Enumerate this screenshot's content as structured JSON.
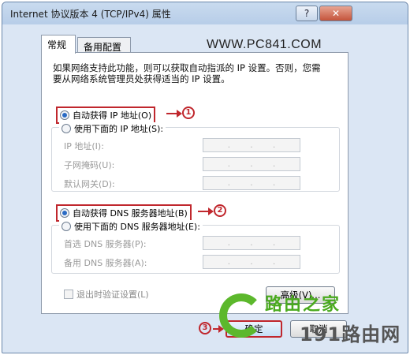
{
  "window": {
    "title": "Internet 协议版本 4 (TCP/IPv4) 属性",
    "help_label": "?",
    "close_label": "✕"
  },
  "tabs": [
    {
      "label": "常规"
    },
    {
      "label": "备用配置"
    }
  ],
  "watermark_top": "WWW.PC841.COM",
  "description": "如果网络支持此功能，则可以获取自动指派的 IP 设置。否则，您需要从网络系统管理员处获得适当的 IP 设置。",
  "ip_section": {
    "auto_label": "自动获得 IP 地址(O)",
    "manual_label": "使用下面的 IP 地址(S):",
    "auto_checked": true,
    "fields": [
      {
        "label": "IP 地址(I):"
      },
      {
        "label": "子网掩码(U):"
      },
      {
        "label": "默认网关(D):"
      }
    ]
  },
  "dns_section": {
    "auto_label": "自动获得 DNS 服务器地址(B)",
    "manual_label": "使用下面的 DNS 服务器地址(E):",
    "auto_checked": true,
    "fields": [
      {
        "label": "首选 DNS 服务器(P):"
      },
      {
        "label": "备用 DNS 服务器(A):"
      }
    ]
  },
  "annotations": {
    "one": "1",
    "two": "2",
    "three": "3"
  },
  "validate_label": "退出时验证设置(L)",
  "advanced_label": "高级(V)...",
  "ok_label": "确定",
  "cancel_label": "取消",
  "ip_dots": ".",
  "logo": {
    "line1": "路由之家",
    "line2": "191路由网"
  },
  "colors": {
    "highlight": "#c0272d",
    "logo_green": "#5cb82c"
  }
}
